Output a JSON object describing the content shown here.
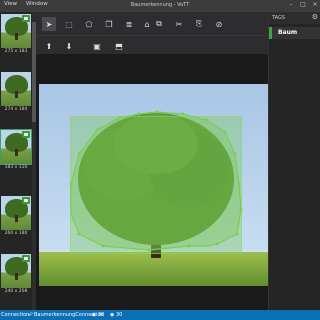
{
  "window": {
    "title": "Baumerkennung - VoTT",
    "menu": [
      "View",
      "Window"
    ]
  },
  "images": [
    {
      "size": "275 x 183",
      "tagged": true,
      "selected": false
    },
    {
      "size": "274 x 184",
      "tagged": false,
      "selected": false
    },
    {
      "size": "183 x 110",
      "tagged": true,
      "selected": true
    },
    {
      "size": "260 x 180",
      "tagged": true,
      "selected": false
    },
    {
      "size": "240 x 208",
      "tagged": true,
      "selected": false
    }
  ],
  "tags_panel": {
    "title": "TAGS",
    "tags": [
      {
        "name": "Baum",
        "color": "#3aa83a"
      }
    ]
  },
  "status": {
    "connection": "Connection",
    "connection_name": "BaumerkennungConnection",
    "tagged_count": "30",
    "visited_count": "30"
  },
  "colors": {
    "accent": "#3aa83a",
    "statusbar": "#0a6fb5",
    "region_fill": "rgba(120,200,80,0.35)"
  }
}
